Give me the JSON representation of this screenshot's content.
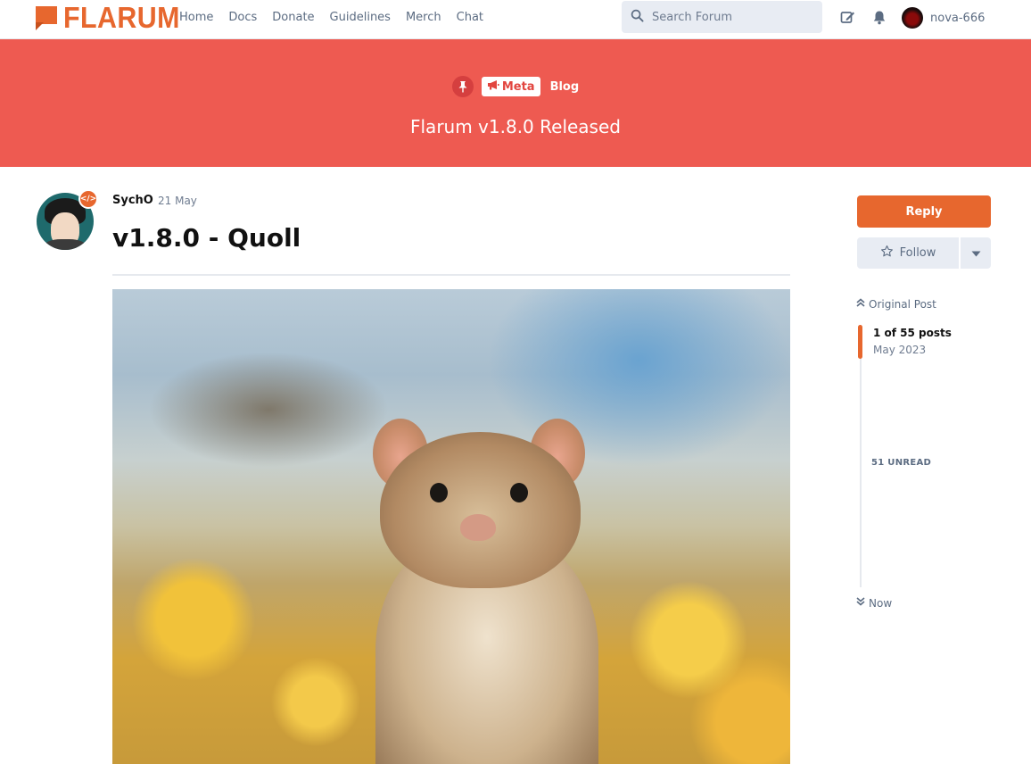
{
  "brand": {
    "logo_text": "FLARUM",
    "accent": "#e7672e",
    "hero_color": "#ee5a51"
  },
  "nav": {
    "items": [
      "Home",
      "Docs",
      "Donate",
      "Guidelines",
      "Merch",
      "Chat"
    ]
  },
  "search": {
    "placeholder": "Search Forum"
  },
  "header": {
    "compose_icon": "pencil-square-icon",
    "notifications_icon": "bell-icon",
    "username": "nova-666"
  },
  "hero": {
    "tags": {
      "pinned_icon": "thumbtack-icon",
      "meta_label": "Meta",
      "meta_icon": "bullhorn-icon",
      "blog_label": "Blog"
    },
    "title": "Flarum v1.8.0 Released"
  },
  "post": {
    "author": "SychO",
    "date": "21 May",
    "title": "v1.8.0 - Quoll",
    "badge_icon": "code-icon",
    "image_alt": "quoll-photo"
  },
  "sidebar": {
    "reply_label": "Reply",
    "follow_label": "Follow",
    "follow_icon": "star-outline-icon",
    "scrubber": {
      "top_label": "Original Post",
      "count_text": "1 of 55 posts",
      "date_text": "May 2023",
      "unread_text": "51 UNREAD",
      "bottom_label": "Now"
    }
  }
}
